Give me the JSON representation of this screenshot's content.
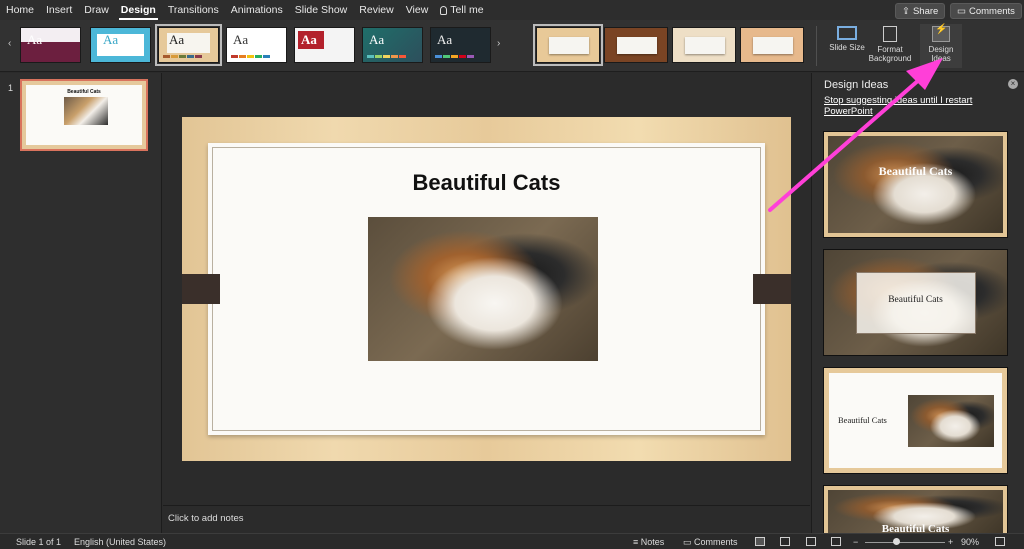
{
  "tabs": [
    "Home",
    "Insert",
    "Draw",
    "Design",
    "Transitions",
    "Animations",
    "Slide Show",
    "Review",
    "View",
    "Tell me"
  ],
  "active_tab": "Design",
  "share_label": "Share",
  "comments_label": "Comments",
  "ribbon": {
    "theme_label": "Aa",
    "slide_size": "Slide Size",
    "format_background": "Format Background",
    "design_ideas": "Design Ideas"
  },
  "slide_panel": {
    "number": "1"
  },
  "slide": {
    "title": "Beautiful Cats"
  },
  "notes_placeholder": "Click to add notes",
  "design_ideas_panel": {
    "title": "Design Ideas",
    "link": "Stop suggesting ideas until I restart PowerPoint",
    "idea_caption": "Beautiful Cats"
  },
  "status": {
    "slide": "Slide 1 of 1",
    "language": "English (United States)",
    "notes": "Notes",
    "comments": "Comments",
    "zoom": "90%"
  },
  "colors": {
    "accent": "#d9735d",
    "annotation_arrow": "#ff3fd8"
  }
}
